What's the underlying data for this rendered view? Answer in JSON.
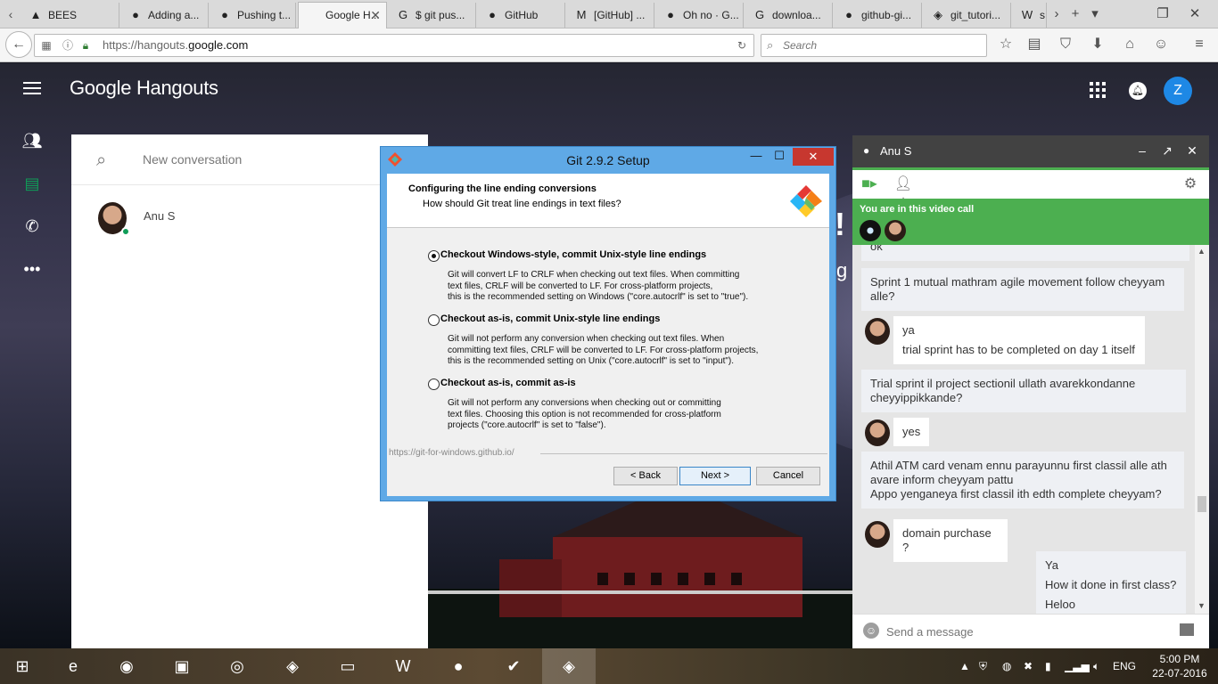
{
  "browser": {
    "tabs": [
      {
        "label": "BEES",
        "icon": "bees-icon",
        "fav": "▲"
      },
      {
        "label": "Adding a...",
        "icon": "github-icon",
        "fav": "●"
      },
      {
        "label": "Pushing t...",
        "icon": "github-icon",
        "fav": "●"
      },
      {
        "label": "Google H...",
        "icon": "google-icon",
        "fav": ""
      },
      {
        "label": "$ git pus...",
        "icon": "google-icon",
        "fav": "G"
      },
      {
        "label": "GitHub",
        "icon": "github-icon",
        "fav": "●"
      },
      {
        "label": "[GitHub] ...",
        "icon": "gmail-icon",
        "fav": "M"
      },
      {
        "label": "Oh no · G...",
        "icon": "github-icon",
        "fav": "●"
      },
      {
        "label": "downloa...",
        "icon": "google-icon",
        "fav": "G"
      },
      {
        "label": "github-gi...",
        "icon": "github-icon",
        "fav": "●"
      },
      {
        "label": "git_tutori...",
        "icon": "git-icon",
        "fav": "◈"
      },
      {
        "label": "s",
        "icon": "wikipedia-icon",
        "fav": "W"
      }
    ],
    "url_prefix": "https://hangouts.",
    "url_domain": "google.com",
    "search_placeholder": "Search"
  },
  "hangouts": {
    "logo": "Google Hangouts",
    "account_initial": "Z",
    "new_conversation": "New conversation",
    "contact_name": "Anu S",
    "bg_text_1": "!",
    "bg_text_2": "g"
  },
  "git_dialog": {
    "title": "Git 2.9.2 Setup",
    "heading": "Configuring the line ending conversions",
    "subheading": "How should Git treat line endings in text files?",
    "options": [
      {
        "label": "Checkout Windows-style, commit Unix-style line endings",
        "selected": true,
        "desc": [
          "Git will convert LF to CRLF when checking out text files. When committing",
          "text files, CRLF will be converted to LF. For cross-platform projects,",
          "this is the recommended setting on Windows (\"core.autocrlf\" is set to \"true\")."
        ]
      },
      {
        "label": "Checkout as-is, commit Unix-style line endings",
        "selected": false,
        "desc": [
          "Git will not perform any conversion when checking out text files. When",
          "committing text files, CRLF will be converted to LF. For cross-platform projects,",
          "this is the recommended setting on Unix (\"core.autocrlf\" is set to \"input\")."
        ]
      },
      {
        "label": "Checkout as-is, commit as-is",
        "selected": false,
        "desc": [
          "Git will not perform any conversions when checking out or committing",
          "text files. Choosing this option is not recommended for cross-platform",
          "projects (\"core.autocrlf\" is set to \"false\")."
        ]
      }
    ],
    "footer_url": "https://git-for-windows.github.io/",
    "back_label": "< Back",
    "next_label": "Next >",
    "cancel_label": "Cancel",
    "minimize_glyph": "—",
    "maximize_glyph": "☐",
    "close_glyph": "✕"
  },
  "chat": {
    "name": "Anu S",
    "video_call_text": "You are in this video call",
    "input_placeholder": "Send a message",
    "messages": [
      {
        "side": "me",
        "lines": [
          "ok"
        ]
      },
      {
        "side": "me",
        "lines": [
          "Sprint 1 mutual mathram agile movement follow cheyyam",
          "alle?"
        ]
      },
      {
        "side": "them",
        "lines": [
          "ya",
          "trial sprint has to be completed on day 1 itself"
        ]
      },
      {
        "side": "me",
        "lines": [
          "Trial sprint il project sectionil ullath avarekkondanne",
          "cheyyippikkande?"
        ]
      },
      {
        "side": "them",
        "lines": [
          "yes"
        ]
      },
      {
        "side": "me",
        "lines": [
          "Athil ATM card venam ennu parayunnu first classil alle ath",
          "avare inform cheyyam pattu",
          "Appo yenganeya first classil ith edth complete cheyyam?"
        ]
      },
      {
        "side": "them",
        "lines": [
          "domain purchase ?"
        ]
      },
      {
        "side": "me",
        "lines": [
          "Ya",
          "How it done in first class?",
          "Heloo"
        ]
      }
    ]
  },
  "taskbar": {
    "language": "ENG",
    "time": "5:00 PM",
    "date": "22-07-2016"
  },
  "colors": {
    "accent_green": "#4caf50",
    "hangouts_blue": "#1e88e5",
    "git_close_red": "#c7372f"
  }
}
